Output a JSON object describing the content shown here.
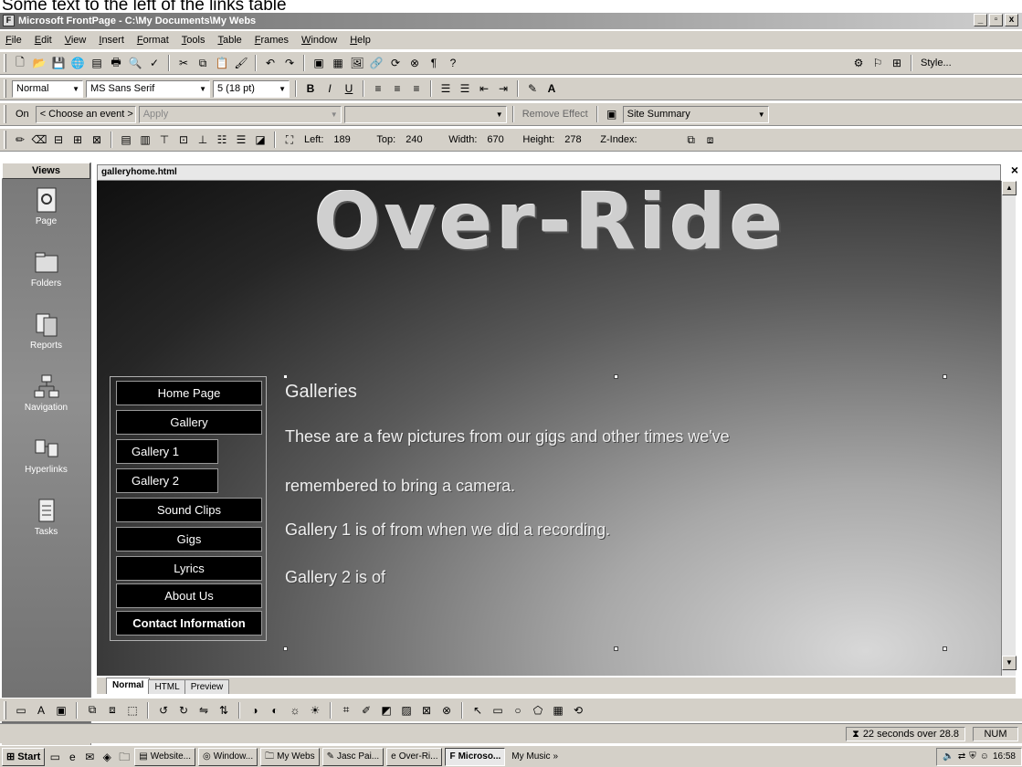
{
  "caption": "Some text to the left of the links table",
  "window": {
    "title": "Microsoft FrontPage - C:\\My Documents\\My Webs",
    "buttons": [
      "_",
      "▫",
      "x"
    ]
  },
  "menu": [
    "File",
    "Edit",
    "View",
    "Insert",
    "Format",
    "Tools",
    "Table",
    "Frames",
    "Window",
    "Help"
  ],
  "toolbar_standard": {
    "style_label": "Style...",
    "icons": [
      "new-icon",
      "open-icon",
      "save-icon",
      "publish-icon",
      "folder-list-icon",
      "print-icon",
      "preview-icon",
      "spelling-icon",
      "cut-icon",
      "copy-icon",
      "paste-icon",
      "format-painter-icon",
      "undo-icon",
      "redo-icon",
      "component-icon",
      "table-icon",
      "picture-icon",
      "hyperlink-icon",
      "refresh-icon",
      "stop-icon",
      "show-all-icon",
      "help-icon"
    ]
  },
  "toolbar_format": {
    "style": "Normal",
    "font": "MS Sans Serif",
    "size": "5 (18 pt)",
    "bold": "B",
    "italic": "I",
    "underline": "U"
  },
  "toolbar_dhtml": {
    "event": "On",
    "choose_event": "< Choose an event >",
    "apply": "Apply",
    "remove_effect": "Remove Effect",
    "site_summary": "Site Summary"
  },
  "toolbar_positioning": {
    "left_label": "Left:",
    "left": "189",
    "top_label": "Top:",
    "top": "240",
    "width_label": "Width:",
    "width": "670",
    "height_label": "Height:",
    "height": "278",
    "zindex_label": "Z-Index:"
  },
  "views": {
    "header": "Views",
    "items": [
      "Page",
      "Folders",
      "Reports",
      "Navigation",
      "Hyperlinks",
      "Tasks"
    ]
  },
  "document": {
    "tab": "galleryhome.html",
    "logo": "Over-Ride",
    "nav": [
      "Home Page",
      "Gallery",
      "Gallery 1",
      "Gallery 2",
      "Sound Clips",
      "Gigs",
      "Lyrics",
      "About Us",
      "Contact Information"
    ],
    "heading": "Galleries",
    "line1": "These are a few pictures from our gigs and other times we've",
    "line2": "remembered to bring a camera.",
    "line3": "Gallery 1 is of from when we did a recording.",
    "line4": "Gallery 2 is of"
  },
  "view_tabs": [
    "Normal",
    "HTML",
    "Preview"
  ],
  "status": {
    "time": "22 seconds over 28.8",
    "num": "NUM"
  },
  "taskbar": {
    "start": "Start",
    "buttons": [
      "Website...",
      "Window...",
      "My Webs",
      "Jasc Pai...",
      "Over-Ri...",
      "Microso...",
      "My Music"
    ],
    "active_index": 5,
    "clock": "16:58"
  }
}
